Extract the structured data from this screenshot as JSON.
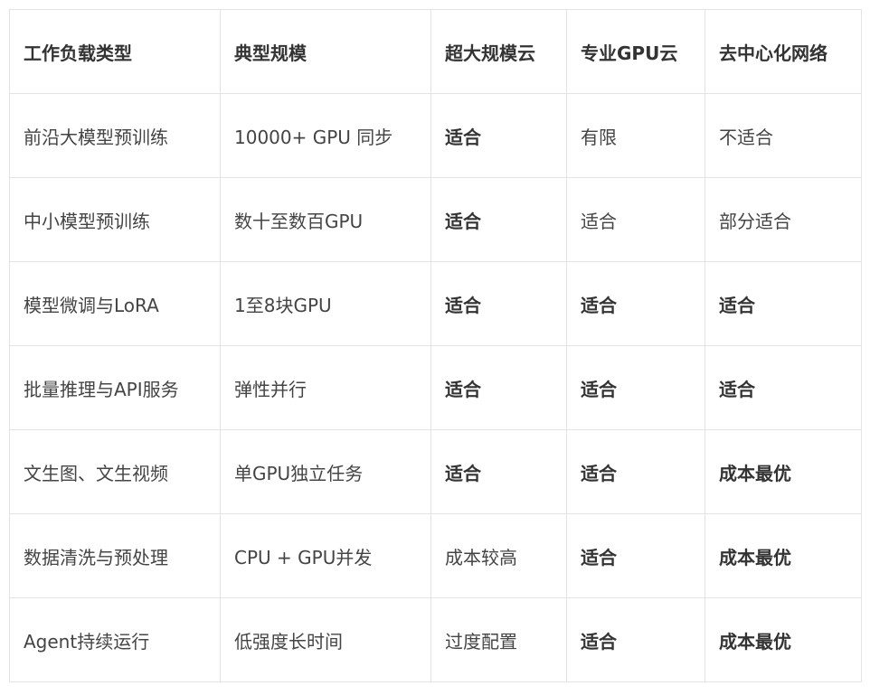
{
  "table": {
    "headers": [
      "工作负载类型",
      "典型规模",
      "超大规模云",
      "专业GPU云",
      "去中心化网络"
    ],
    "rows": [
      {
        "cells": [
          "前沿大模型预训练",
          "10000+ GPU 同步",
          "适合",
          "有限",
          "不适合"
        ],
        "bold": [
          false,
          false,
          true,
          false,
          false
        ]
      },
      {
        "cells": [
          "中小模型预训练",
          "数十至数百GPU",
          "适合",
          "适合",
          "部分适合"
        ],
        "bold": [
          false,
          false,
          true,
          false,
          false
        ]
      },
      {
        "cells": [
          "模型微调与LoRA",
          "1至8块GPU",
          "适合",
          "适合",
          "适合"
        ],
        "bold": [
          false,
          false,
          true,
          true,
          true
        ]
      },
      {
        "cells": [
          "批量推理与API服务",
          "弹性并行",
          "适合",
          "适合",
          "适合"
        ],
        "bold": [
          false,
          false,
          true,
          true,
          true
        ]
      },
      {
        "cells": [
          "文生图、文生视频",
          "单GPU独立任务",
          "适合",
          "适合",
          "成本最优"
        ],
        "bold": [
          false,
          false,
          true,
          true,
          true
        ]
      },
      {
        "cells": [
          "数据清洗与预处理",
          "CPU + GPU并发",
          "成本较高",
          "适合",
          "成本最优"
        ],
        "bold": [
          false,
          false,
          false,
          true,
          true
        ]
      },
      {
        "cells": [
          "Agent持续运行",
          "低强度长时间",
          "过度配置",
          "适合",
          "成本最优"
        ],
        "bold": [
          false,
          false,
          false,
          true,
          true
        ]
      }
    ]
  }
}
